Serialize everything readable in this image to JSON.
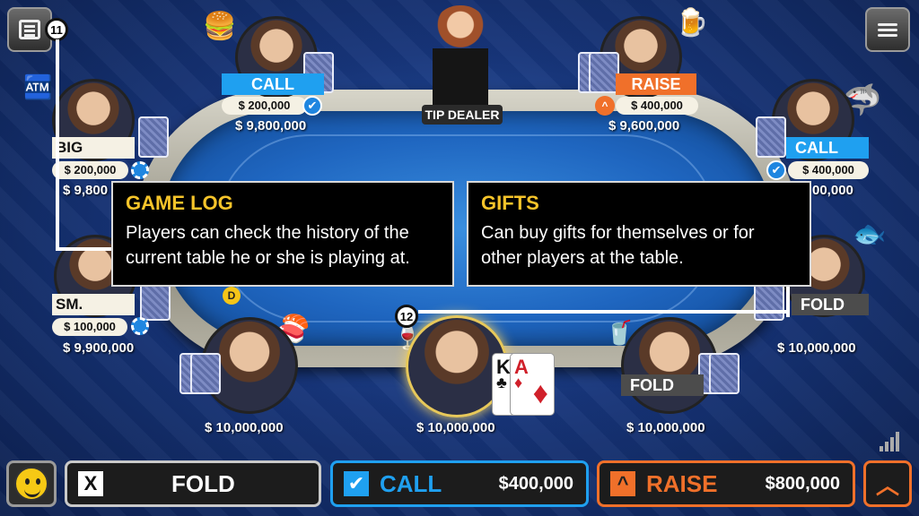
{
  "dealer": {
    "label": "TIP DEALER"
  },
  "players": {
    "top_left": {
      "action": "CALL",
      "bet": "$ 200,000",
      "stack": "$ 9,800,000"
    },
    "top_right": {
      "action": "RAISE",
      "bet": "$ 400,000",
      "stack": "$ 9,600,000"
    },
    "left_upper": {
      "action": "BIG BLIND",
      "bet": "$ 200,000",
      "stack": "$ 9,800"
    },
    "right_upper": {
      "action": "CALL",
      "bet": "$ 400,000",
      "stack": "00,000"
    },
    "left_lower": {
      "action": "SM. BLIND",
      "bet": "$ 100,000",
      "stack": "$ 9,900,000"
    },
    "right_lower": {
      "action": "FOLD",
      "stack": "$ 10,000,000"
    },
    "bottom_left": {
      "stack": "$ 10,000,000"
    },
    "hero": {
      "stack": "$ 10,000,000",
      "cards": [
        {
          "rank": "K",
          "suit": "♣"
        },
        {
          "rank": "A",
          "suit": "♦"
        }
      ]
    },
    "bottom_right": {
      "action": "FOLD",
      "stack": "$ 10,000,000"
    }
  },
  "dealer_button": "D",
  "badges": {
    "game_log": "11",
    "gifts": "12"
  },
  "popups": {
    "game_log": {
      "title": "GAME LOG",
      "text": "Players can check the history of the current table he or she is playing at."
    },
    "gifts": {
      "title": "GIFTS",
      "text": "Can buy gifts for themselves or for other players at the table."
    }
  },
  "action_bar": {
    "fold": {
      "icon": "X",
      "label": "FOLD"
    },
    "call": {
      "icon": "✔",
      "label": "CALL",
      "amount": "$400,000"
    },
    "raise": {
      "icon": "^",
      "label": "RAISE",
      "amount": "$800,000"
    }
  },
  "colors": {
    "call": "#1fa0f0",
    "raise": "#f0702a",
    "fold": "#4c4c4c",
    "title": "#f6c42a"
  },
  "icons": [
    "game-log-icon",
    "menu-icon",
    "emoji-icon",
    "chevron-up-icon",
    "signal-icon",
    "check-icon",
    "atm-icon",
    "burger-gift-icon",
    "beer-gift-icon",
    "shark-gift-icon",
    "koi-gift-icon",
    "sushi-gift-icon",
    "wine-gift-icon",
    "water-gift-icon"
  ]
}
